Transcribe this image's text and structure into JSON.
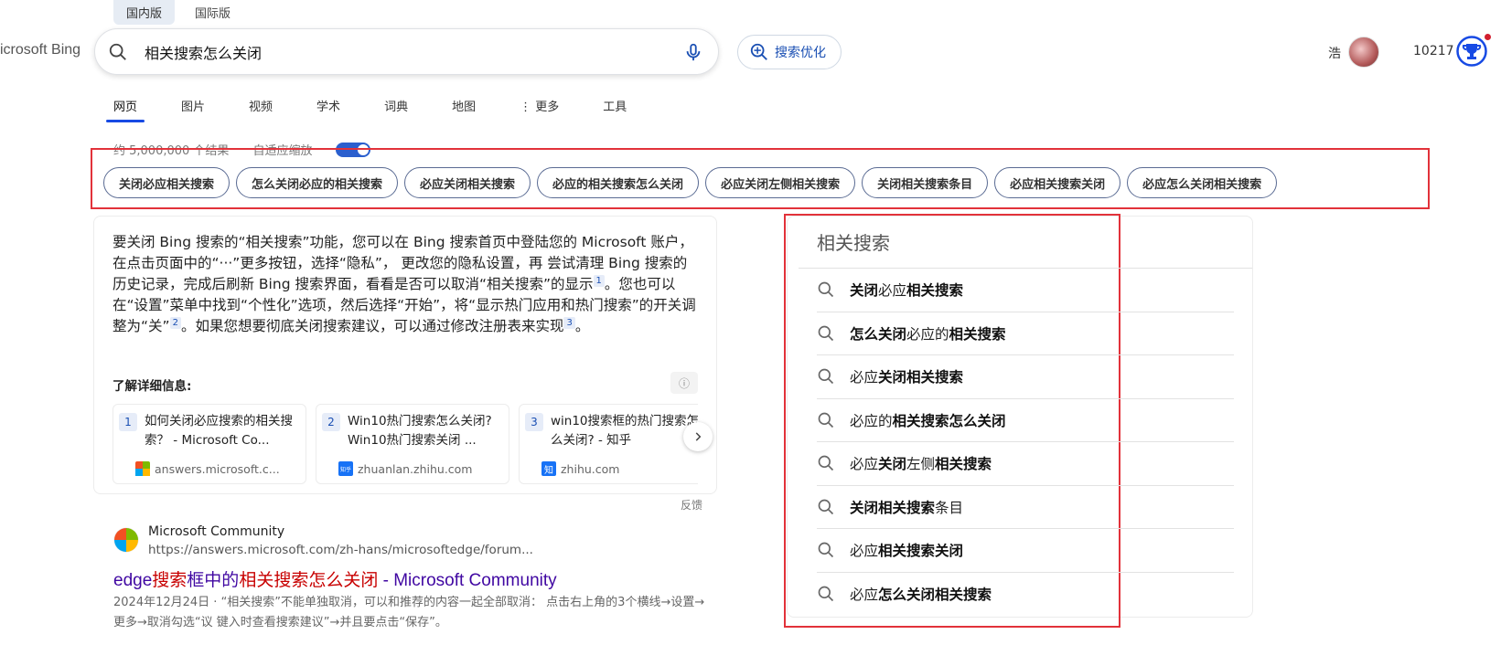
{
  "region_tabs": [
    "国内版",
    "国际版"
  ],
  "logo": "icrosoft Bing",
  "search": {
    "query": "相关搜索怎么关闭"
  },
  "optimize_label": "搜索优化",
  "user": {
    "name": "浩",
    "points": "10217"
  },
  "nav": [
    "网页",
    "图片",
    "视频",
    "学术",
    "词典",
    "地图",
    "⋮ 更多",
    "工具"
  ],
  "result_count": "约 5,000,000 个结果",
  "adaptive_zoom": "自适应缩放",
  "chips": [
    "关闭必应相关搜索",
    "怎么关闭必应的相关搜索",
    "必应关闭相关搜索",
    "必应的相关搜索怎么关闭",
    "必应关闭左侧相关搜索",
    "关闭相关搜索条目",
    "必应相关搜索关闭",
    "必应怎么关闭相关搜索"
  ],
  "answer": {
    "p1": "要关闭 Bing 搜索的“相关搜索”功能，您可以在 Bing 搜索首页中登陆您的 Microsoft 账户，在点击页面中的“···”更多按钮，选择“隐私”， 更改您的隐私设置，再 尝试清理 Bing 搜索的历史记录，完成后刷新 Bing 搜索界面，看看是否可以取消“相关搜索”的显示",
    "c1": "1",
    "p2": "。您也可以在“设置”菜单中找到“个性化”选项，然后选择“开始”，将“显示热门应用和热门搜索”的开关调整为“关”",
    "c2": "2",
    "p3": "。如果您想要彻底关闭搜索建议，可以通过修改注册表来实现",
    "c3": "3",
    "p4": "。",
    "learn_more": "了解详细信息:",
    "info": "ⓘ"
  },
  "sources": [
    {
      "num": "1",
      "title": "如何关闭必应搜索的相关搜索？ - Microsoft Co...",
      "domain": "answers.microsoft.c..."
    },
    {
      "num": "2",
      "title": "Win10热门搜索怎么关闭?Win10热门搜索关闭 ...",
      "domain": "zhuanlan.zhihu.com"
    },
    {
      "num": "3",
      "title": "win10搜索框的热门搜索怎么关闭? - 知乎",
      "domain": "zhihu.com"
    }
  ],
  "zhihu_fav": "知",
  "zhihu_fav_small": "知乎",
  "feedback": "反馈",
  "result": {
    "site": "Microsoft Community",
    "url": "https://answers.microsoft.com/zh-hans/microsoftedge/forum...",
    "title_a": "edge",
    "title_b": "搜索",
    "title_c": "框中的",
    "title_d": "相关搜索怎么关闭",
    "title_e": " - Microsoft Community",
    "snippet": "2024年12月24日 · “相关搜索”不能单独取消，可以和推荐的内容一起全部取消： 点击右上角的3个横线→设置→更多→取消勾选“议 键入时查看搜索建议”→并且要点击“保存”。"
  },
  "related": {
    "title": "相关搜索",
    "items": [
      [
        {
          "t": "关闭",
          "b": true
        },
        {
          "t": "必应",
          "b": false
        },
        {
          "t": "相关搜索",
          "b": true
        }
      ],
      [
        {
          "t": "怎么关闭",
          "b": true
        },
        {
          "t": "必应的",
          "b": false
        },
        {
          "t": "相关搜索",
          "b": true
        }
      ],
      [
        {
          "t": "必应",
          "b": false
        },
        {
          "t": "关闭相关搜索",
          "b": true
        }
      ],
      [
        {
          "t": "必应的",
          "b": false
        },
        {
          "t": "相关搜索怎么关闭",
          "b": true
        }
      ],
      [
        {
          "t": "必应",
          "b": false
        },
        {
          "t": "关闭",
          "b": true
        },
        {
          "t": "左侧",
          "b": false
        },
        {
          "t": "相关搜索",
          "b": true
        }
      ],
      [
        {
          "t": "关闭相关搜索",
          "b": true
        },
        {
          "t": "条目",
          "b": false
        }
      ],
      [
        {
          "t": "必应",
          "b": false
        },
        {
          "t": "相关搜索关闭",
          "b": true
        }
      ],
      [
        {
          "t": "必应",
          "b": false
        },
        {
          "t": "怎么关闭相关搜索",
          "b": true
        }
      ]
    ]
  },
  "colors": {
    "accent": "#174ae4",
    "highlight_box": "#e2323a",
    "visited_link": "#4007a2",
    "match": "#c80000"
  }
}
